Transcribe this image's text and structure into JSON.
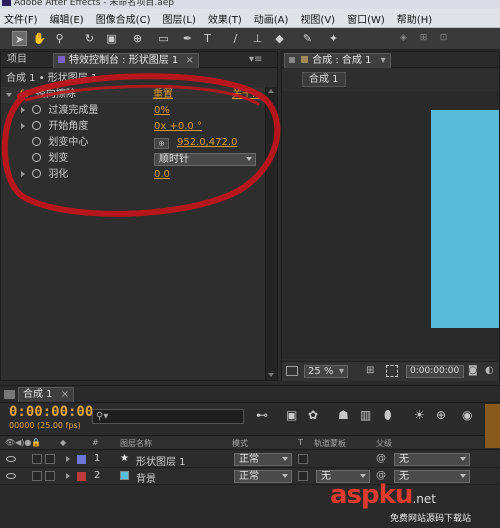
{
  "window": {
    "title": "Adobe After Effects - 未命名项目.aep"
  },
  "menu": {
    "items": [
      "文件(F)",
      "编辑(E)",
      "图像合成(C)",
      "图层(L)",
      "效果(T)",
      "动画(A)",
      "视图(V)",
      "窗口(W)",
      "帮助(H)"
    ]
  },
  "toolbar": {
    "icons": [
      "selection-arrow",
      "hand",
      "zoom",
      "rotate",
      "camera",
      "pan-behind",
      "rectangle",
      "pen",
      "type",
      "brush",
      "clone-stamp",
      "eraser",
      "roto-brush",
      "puppet-pin"
    ]
  },
  "left_panel": {
    "tabs": [
      "项目",
      "特效控制台 : 形状图层 1"
    ],
    "tab_close": "×",
    "breadcrumb": "合成 1 • 形状图层 1",
    "effect": {
      "name": "径向擦除",
      "reset": "重置",
      "about": "关于..."
    },
    "properties": [
      {
        "label": "过渡完成量",
        "value": "0%"
      },
      {
        "label": "开始角度",
        "value": "0x +0.0 °"
      },
      {
        "label": "划变中心",
        "value": "952.0,472.0"
      },
      {
        "label": "划变",
        "value": "顺时针"
      },
      {
        "label": "羽化",
        "value": "0.0"
      }
    ]
  },
  "viewer": {
    "tab": "合成 : 合成 1",
    "comp_button": "合成 1",
    "zoom": "25 %",
    "time": "0:00:00:00",
    "comp_color": "#59bcd8"
  },
  "timeline": {
    "tab": "合成 1",
    "timecode": "0:00:00:00",
    "fps": "00000 (25.00 fps)",
    "search_placeholder": "",
    "columns": {
      "num": "#",
      "name": "图层名称",
      "mode": "模式",
      "t": "T",
      "trkmat": "轨道蒙板",
      "parent": "父级"
    },
    "layers": [
      {
        "num": "1",
        "name": "形状图层 1",
        "color": "#6b78d8",
        "mode": "正常",
        "trkmat": "",
        "parent": "无",
        "icon": "★"
      },
      {
        "num": "2",
        "name": "背景",
        "color": "#c0393b",
        "mode": "正常",
        "trkmat": "无",
        "parent": "无",
        "icon": ""
      }
    ]
  },
  "watermark": {
    "text": "aspku",
    "suffix": ".net",
    "tagline": "免费网站源码下载站"
  },
  "colors": {
    "accent_orange": "#d99a2b",
    "annotation_red": "#c3161b"
  }
}
